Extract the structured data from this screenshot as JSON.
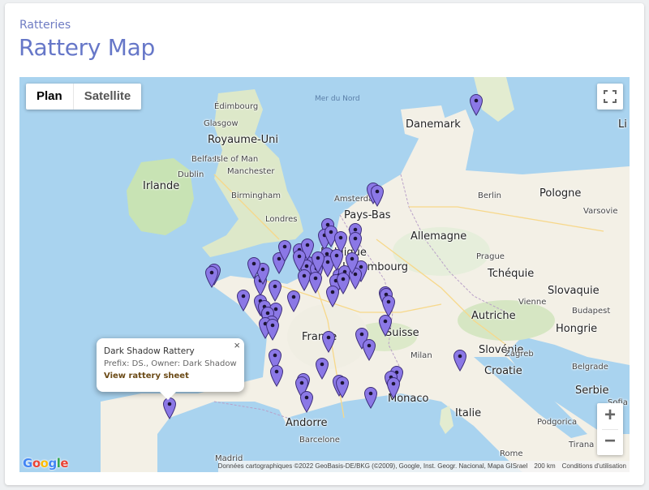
{
  "header": {
    "breadcrumb": "Ratteries",
    "title": "Rattery Map"
  },
  "map_controls": {
    "plan_label": "Plan",
    "satellite_label": "Satellite",
    "zoom_in": "+",
    "zoom_out": "−"
  },
  "popup": {
    "title": "Dark Shadow Rattery",
    "subtitle": "Prefix: DS., Owner: Dark Shadow",
    "link": "View rattery sheet",
    "close": "×"
  },
  "attribution": {
    "data": "Données cartographiques ©2022 GeoBasis-DE/BKG (©2009), Google, Inst. Geogr. Nacional, Mapa GISrael",
    "scale": "200 km",
    "terms": "Conditions d'utilisation"
  },
  "map_labels": {
    "mer_du_nord": "Mer du Nord",
    "danemark": "Danemark",
    "edimbourg": "Édimbourg",
    "glasgow": "Glasgow",
    "royaume_uni": "Royaume-Uni",
    "belfast": "Belfast",
    "isle_of_man": "Isle of Man",
    "dublin": "Dublin",
    "irlande": "Irlande",
    "manchester": "Manchester",
    "birmingham": "Birmingham",
    "londres": "Londres",
    "amsterdam": "Amsterdam",
    "pays_bas": "Pays-Bas",
    "berlin": "Berlin",
    "pologne": "Pologne",
    "varsovie": "Varsovie",
    "allemagne": "Allemagne",
    "belgique": "Belgique",
    "luxembourg": "Luxembourg",
    "prague": "Prague",
    "tchequie": "Tchéquie",
    "slovaquie": "Slovaquie",
    "vienne": "Vienne",
    "autriche": "Autriche",
    "budapest": "Budapest",
    "hongrie": "Hongrie",
    "france": "France",
    "suisse": "Suisse",
    "milan": "Milan",
    "slovenie": "Slovénie",
    "croatie": "Croatie",
    "zagreb": "Zagreb",
    "belgrade": "Belgrade",
    "serbie": "Serbie",
    "monaco": "Monaco",
    "italie": "Italie",
    "andorre": "Andorre",
    "barcelone": "Barcelone",
    "madrid": "Madrid",
    "rome": "Rome",
    "podgorica": "Podgorica",
    "sofia": "Sofia",
    "tirana": "Tirana",
    "li": "Li"
  },
  "marker_count": 67,
  "marker_color": "#8b78e6",
  "colors": {
    "land": "#f4f1ea",
    "sea": "#a9d3ef",
    "title": "#6677c8",
    "breadcrumb": "#6f7cc3"
  },
  "icons": [
    "fullscreen-icon",
    "map-pin-icon",
    "close-icon"
  ]
}
